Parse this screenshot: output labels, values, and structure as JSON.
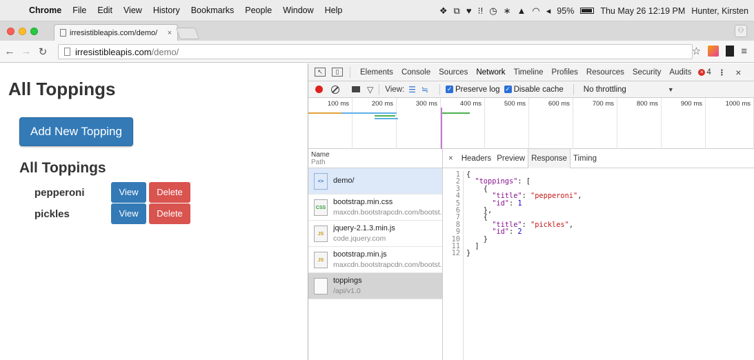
{
  "menubar": {
    "app_name": "Chrome",
    "items": [
      "File",
      "Edit",
      "View",
      "History",
      "Bookmarks",
      "People",
      "Window",
      "Help"
    ],
    "battery": "95%",
    "datetime": "Thu May 26  12:19 PM",
    "user": "Hunter, Kirsten"
  },
  "tab": {
    "title": "irresistibleapis.com/demo/",
    "close": "×"
  },
  "toolbar": {
    "url_host": "irresistibleapis.com",
    "url_path": "/demo/"
  },
  "page": {
    "title": "All Toppings",
    "add_button": "Add New Topping",
    "subtitle": "All Toppings",
    "toppings": [
      {
        "name": "pepperoni",
        "view": "View",
        "delete": "Delete"
      },
      {
        "name": "pickles",
        "view": "View",
        "delete": "Delete"
      }
    ]
  },
  "devtools": {
    "tabs": [
      "Elements",
      "Console",
      "Sources",
      "Network",
      "Timeline",
      "Profiles",
      "Resources",
      "Security",
      "Audits"
    ],
    "active_tab": "Network",
    "error_count": "4",
    "controls": {
      "view_label": "View:",
      "preserve_log": "Preserve log",
      "disable_cache": "Disable cache",
      "throttling": "No throttling"
    },
    "timeline_ticks": [
      "100 ms",
      "200 ms",
      "300 ms",
      "400 ms",
      "500 ms",
      "600 ms",
      "700 ms",
      "800 ms",
      "900 ms",
      "1000 ms"
    ],
    "name_header": "Name",
    "path_header": "Path",
    "requests": [
      {
        "name": "demo/",
        "path": "",
        "icon": "<>",
        "state": "selected"
      },
      {
        "name": "bootstrap.min.css",
        "path": "maxcdn.bootstrapcdn.com/bootst...",
        "icon": "CSS",
        "state": ""
      },
      {
        "name": "jquery-2.1.3.min.js",
        "path": "code.jquery.com",
        "icon": "JS",
        "state": ""
      },
      {
        "name": "bootstrap.min.js",
        "path": "maxcdn.bootstrapcdn.com/bootst...",
        "icon": "JS",
        "state": ""
      },
      {
        "name": "toppings",
        "path": "/api/v1.0",
        "icon": "",
        "state": "grey"
      }
    ],
    "detail_tabs": [
      "Headers",
      "Preview",
      "Response",
      "Timing"
    ],
    "active_detail_tab": "Response",
    "response_lines": [
      "{",
      "  \"toppings\": [",
      "    {",
      "      \"title\": \"pepperoni\",",
      "      \"id\": 1",
      "    },",
      "    {",
      "      \"title\": \"pickles\",",
      "      \"id\": 2",
      "    }",
      "  ]",
      "}"
    ]
  }
}
